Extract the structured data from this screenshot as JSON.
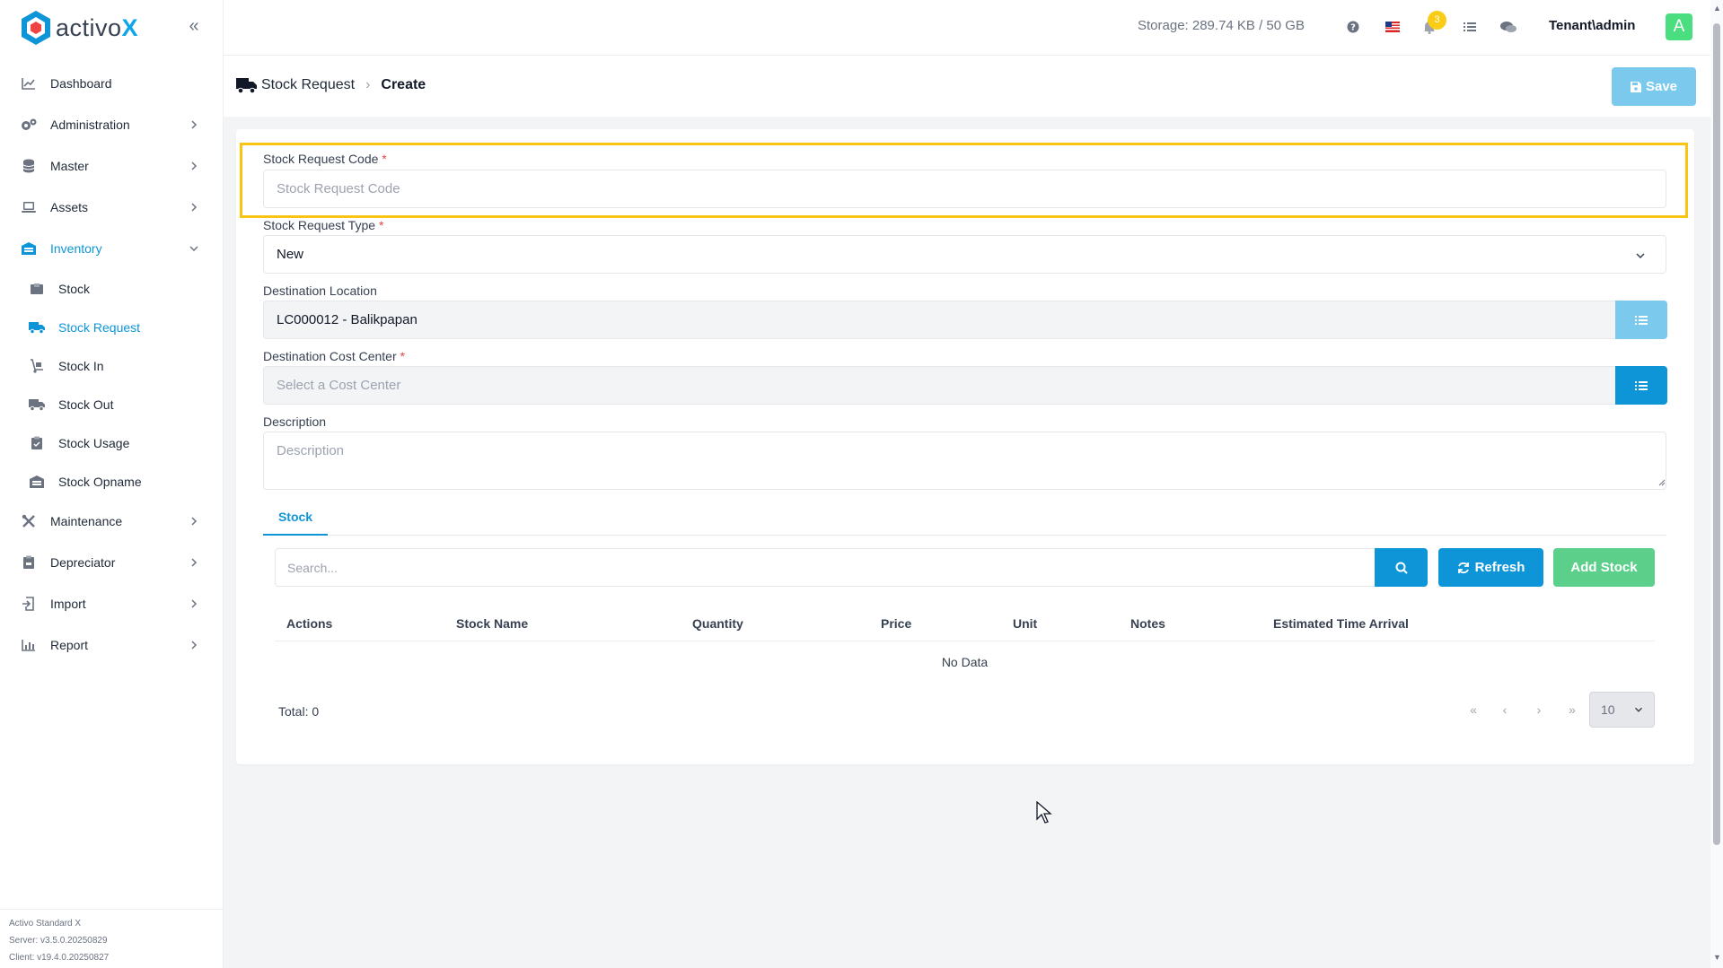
{
  "app": {
    "logo_text": "activo",
    "logo_x": "X"
  },
  "sidebar": {
    "items": [
      {
        "label": "Dashboard",
        "icon": "chart-line-icon"
      },
      {
        "label": "Administration",
        "icon": "gears-icon"
      },
      {
        "label": "Master",
        "icon": "database-icon"
      },
      {
        "label": "Assets",
        "icon": "laptop-icon"
      },
      {
        "label": "Inventory",
        "icon": "warehouse-icon"
      },
      {
        "label": "Maintenance",
        "icon": "tools-icon"
      },
      {
        "label": "Depreciator",
        "icon": "clipboard-icon"
      },
      {
        "label": "Import",
        "icon": "import-icon"
      },
      {
        "label": "Report",
        "icon": "bar-chart-icon"
      }
    ],
    "inventory_sub": [
      {
        "label": "Stock"
      },
      {
        "label": "Stock Request"
      },
      {
        "label": "Stock In"
      },
      {
        "label": "Stock Out"
      },
      {
        "label": "Stock Usage"
      },
      {
        "label": "Stock Opname"
      }
    ],
    "footer": {
      "product": "Activo Standard X",
      "server": "Server: v3.5.0.20250829",
      "client": "Client: v19.4.0.20250827"
    }
  },
  "topbar": {
    "storage": "Storage: 289.74 KB / 50 GB",
    "notification_count": "3",
    "user": "Tenant\\admin",
    "avatar_letter": "A"
  },
  "header": {
    "breadcrumb_parent": "Stock Request",
    "breadcrumb_current": "Create",
    "save_label": "Save"
  },
  "form": {
    "code_label": "Stock Request Code",
    "code_placeholder": "Stock Request Code",
    "type_label": "Stock Request Type",
    "type_value": "New",
    "location_label": "Destination Location",
    "location_value": "LC000012 - Balikpapan",
    "cost_center_label": "Destination Cost Center",
    "cost_center_placeholder": "Select a Cost Center",
    "description_label": "Description",
    "description_placeholder": "Description",
    "required_mark": "*"
  },
  "stock_tab": {
    "tab_label": "Stock",
    "search_placeholder": "Search...",
    "refresh_label": "Refresh",
    "add_label": "Add Stock",
    "columns": [
      "Actions",
      "Stock Name",
      "Quantity",
      "Price",
      "Unit",
      "Notes",
      "Estimated Time Arrival"
    ],
    "no_data": "No Data",
    "total": "Total: 0",
    "page_size": "10"
  },
  "colors": {
    "primary": "#0e95d8",
    "success": "#5ccf8a",
    "highlight": "#fac415"
  }
}
